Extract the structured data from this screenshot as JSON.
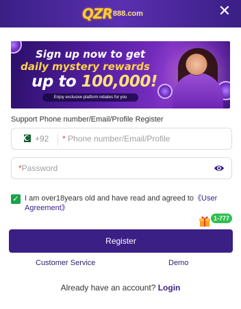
{
  "header": {
    "logo_main": "QZR",
    "logo_badge": "888",
    "logo_sub": "888.com",
    "close_glyph": "✕"
  },
  "banner": {
    "line1": "Sign up now to get",
    "line2": "daily mystery rewards",
    "line3_prefix": "up to ",
    "line3_amount": "100,000!",
    "subtext": "Enjoy exclusive platform rebates for you"
  },
  "form": {
    "support_label": "Support Phone number/Email/Profile Register",
    "country_code": "+92",
    "required_mark": "*",
    "phone_placeholder": "Phone number/Email/Profile",
    "password_placeholder": "Password",
    "agree_text": "I am over18years old and have read and agreed to",
    "agree_link": "《User Agreement》",
    "checkbox_glyph": "✓",
    "register_label": "Register"
  },
  "promo": {
    "badge": "1-777"
  },
  "links": {
    "customer_service": "Customer Service",
    "demo": "Demo",
    "login_prompt": "Already have an account?",
    "login": "Login"
  },
  "colors": {
    "brand": "#3a1f85",
    "accent_green": "#1aa34a",
    "required": "#e54545"
  },
  "icons": {
    "close": "close-icon",
    "flag": "pakistan-flag-icon",
    "eye": "eye-icon",
    "check": "checkmark-icon",
    "gift": "gift-icon"
  }
}
